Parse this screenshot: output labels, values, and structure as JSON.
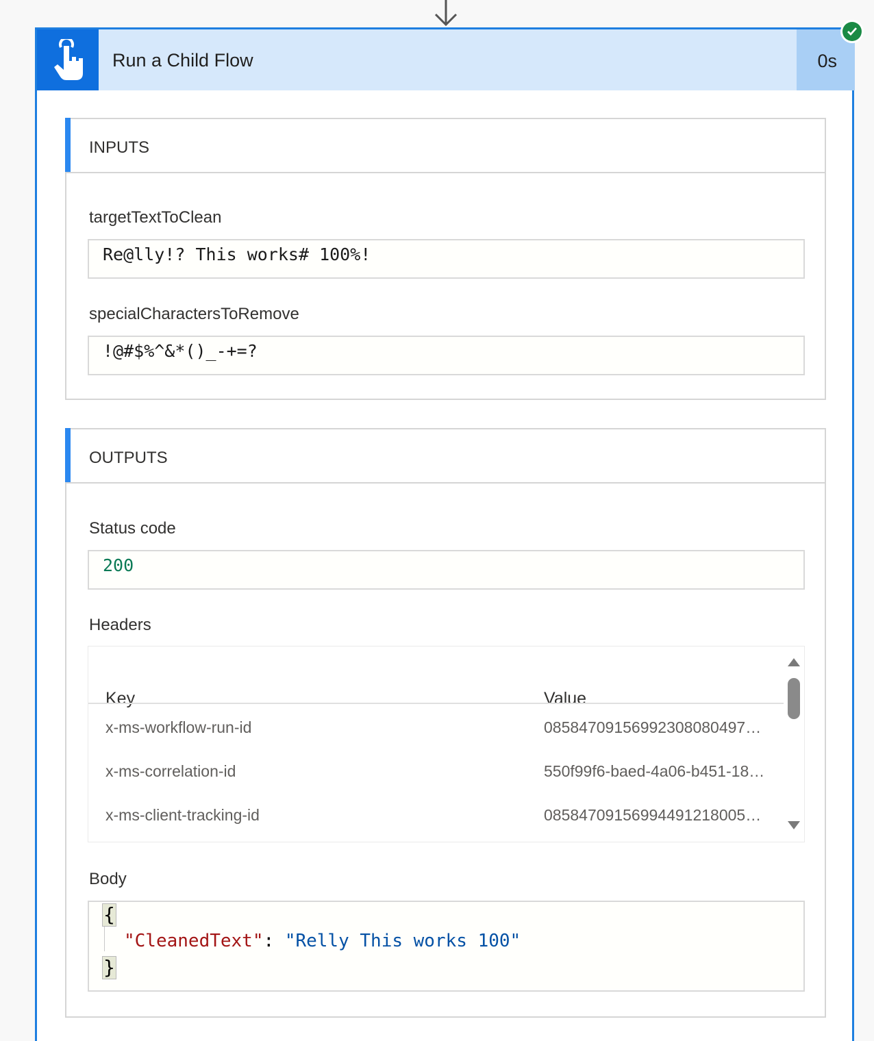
{
  "action": {
    "title": "Run a Child Flow",
    "duration": "0s",
    "icon": "touch-hand-icon",
    "status_icon": "success-check-icon",
    "colors": {
      "accent": "#0f6fde",
      "header_bg": "#d6e8fb",
      "border": "#1e7fe0",
      "success": "#1a8a45"
    }
  },
  "inputs": {
    "title": "INPUTS",
    "fields": [
      {
        "label": "targetTextToClean",
        "value": "Re@lly!? This works# 100%!"
      },
      {
        "label": "specialCharactersToRemove",
        "value": "!@#$%^&*()_-+=?"
      }
    ]
  },
  "outputs": {
    "title": "OUTPUTS",
    "status_code": {
      "label": "Status code",
      "value": "200"
    },
    "headers": {
      "label": "Headers",
      "columns": {
        "key": "Key",
        "value": "Value"
      },
      "rows": [
        {
          "key": "x-ms-workflow-run-id",
          "value": "08584709156992308080497…"
        },
        {
          "key": "x-ms-correlation-id",
          "value": "550f99f6-baed-4a06-b451-18…"
        },
        {
          "key": "x-ms-client-tracking-id",
          "value": "08584709156994491218005…"
        }
      ]
    },
    "body": {
      "label": "Body",
      "open_brace": "{",
      "close_brace": "}",
      "key": "\"CleanedText\"",
      "colon": ": ",
      "value": "\"Relly This works 100\""
    }
  }
}
